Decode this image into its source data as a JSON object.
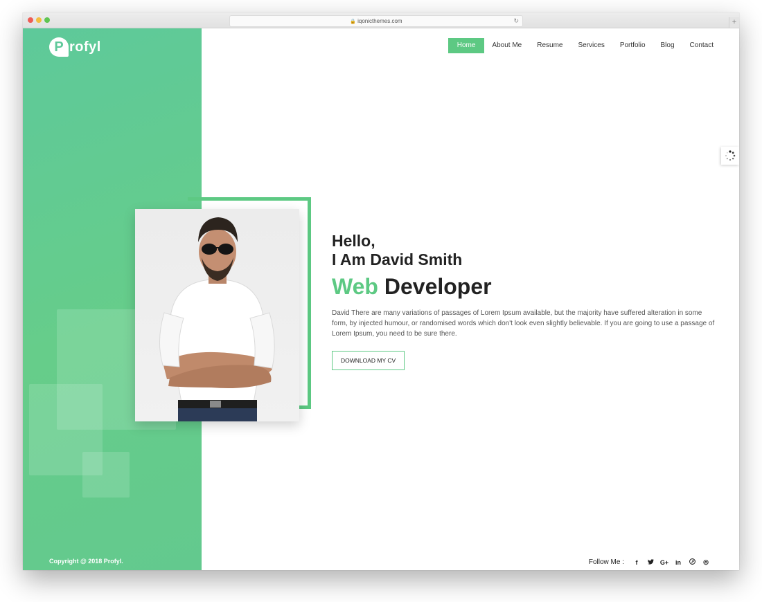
{
  "browser": {
    "url": "iqonicthemes.com",
    "new_tab": "+"
  },
  "logo": {
    "mark": "P",
    "text": "rofyl"
  },
  "nav": {
    "items": [
      {
        "label": "Home",
        "active": true
      },
      {
        "label": "About Me",
        "active": false
      },
      {
        "label": "Resume",
        "active": false
      },
      {
        "label": "Services",
        "active": false
      },
      {
        "label": "Portfolio",
        "active": false
      },
      {
        "label": "Blog",
        "active": false
      },
      {
        "label": "Contact",
        "active": false
      }
    ]
  },
  "hero": {
    "greeting": "Hello,",
    "name_line": "I Am David Smith",
    "role_accent": "Web",
    "role_rest": " Developer",
    "description": "David There are many variations of passages of Lorem Ipsum available, but the majority have suffered alteration in some form, by injected humour, or randomised words which don't look even slightly believable. If you are going to use a passage of Lorem Ipsum, you need to be sure there.",
    "cta_label": "DOWNLOAD MY CV"
  },
  "footer": {
    "copyright": "Copyright @ 2018 Profyl.",
    "follow_label": "Follow Me :",
    "social": [
      {
        "icon": "facebook-icon",
        "glyph": "f"
      },
      {
        "icon": "twitter-icon",
        "glyph": "t"
      },
      {
        "icon": "google-plus-icon",
        "glyph": "G+"
      },
      {
        "icon": "linkedin-icon",
        "glyph": "in"
      },
      {
        "icon": "pinterest-icon",
        "glyph": "p"
      },
      {
        "icon": "dribbble-icon",
        "glyph": "◎"
      }
    ]
  },
  "colors": {
    "accent": "#5dc983",
    "sidebar_start": "#5ec99a",
    "sidebar_end": "#66cd8a",
    "text_dark": "#222222"
  }
}
